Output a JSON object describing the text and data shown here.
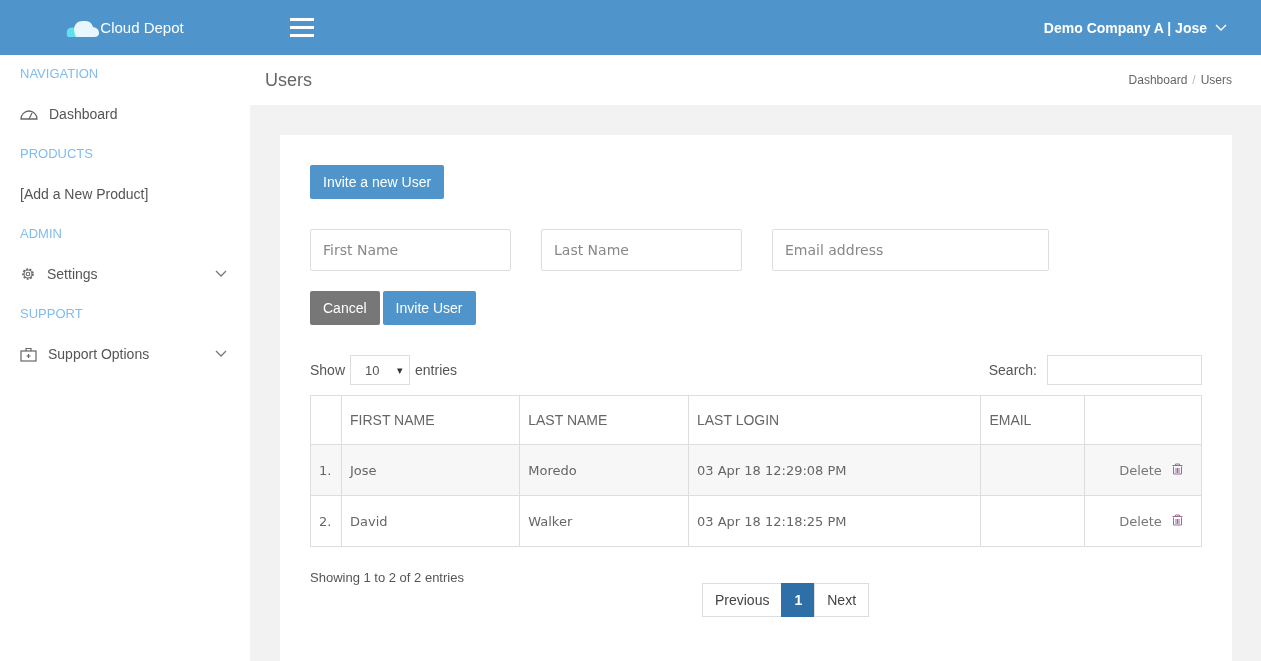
{
  "header": {
    "logo": "Cloud Depot",
    "account": "Demo Company A | Jose"
  },
  "sidebar": {
    "sections": [
      {
        "title": "NAVIGATION",
        "items": [
          {
            "kind": "icon-link",
            "label": "Dashboard",
            "expandable": false
          }
        ]
      },
      {
        "title": "PRODUCTS",
        "items": [
          {
            "kind": "text-link",
            "label": "[Add a New Product]",
            "expandable": false
          }
        ]
      },
      {
        "title": "ADMIN",
        "items": [
          {
            "kind": "icon-link",
            "label": "Settings",
            "expandable": true
          }
        ]
      },
      {
        "title": "SUPPORT",
        "items": [
          {
            "kind": "icon-link",
            "label": "Support Options",
            "expandable": true
          }
        ]
      }
    ]
  },
  "page": {
    "title": "Users",
    "breadcrumb": [
      "Dashboard",
      "Users"
    ],
    "breadcrumb_separator": "/"
  },
  "invite_button": "Invite a new User",
  "invite_form": {
    "fields": [
      {
        "placeholder": "First Name"
      },
      {
        "placeholder": "Last Name"
      },
      {
        "placeholder": "Email address"
      }
    ],
    "cancel": "Cancel",
    "submit": "Invite User"
  },
  "table": {
    "show_label": "Show",
    "page_size": "10",
    "page_size_arrow": "▾",
    "entries_label": "entries",
    "search_label": "Search:",
    "columns": [
      "",
      "FIRST NAME",
      "LAST NAME",
      "LAST LOGIN",
      "EMAIL",
      ""
    ],
    "rows": [
      {
        "index": "1.",
        "first_name": "Jose",
        "last_name": "Moredo",
        "last_login": "03 Apr 18 12:29:08 PM",
        "action": "Delete"
      },
      {
        "index": "2.",
        "first_name": "David",
        "last_name": "Walker",
        "last_login": "03 Apr 18 12:18:25 PM",
        "action": "Delete"
      }
    ],
    "info": "Showing 1 to 2 of 2 entries",
    "pagination": {
      "previous": "Previous",
      "pages": [
        {
          "label": "1",
          "selected": true
        }
      ],
      "next": "Next"
    }
  }
}
